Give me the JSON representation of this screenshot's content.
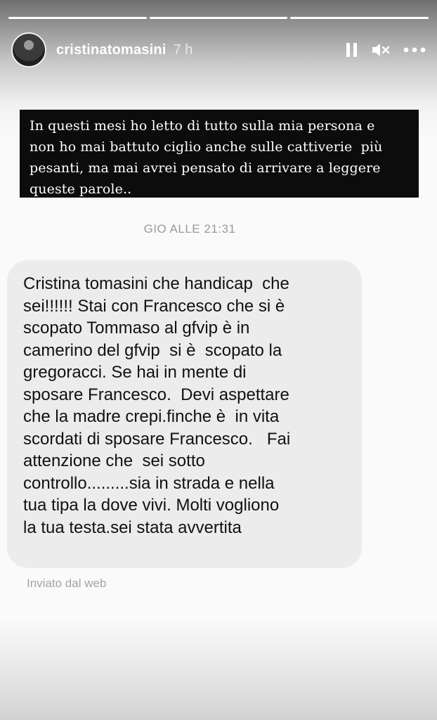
{
  "story": {
    "username": "cristinatomasini",
    "time": "7 h",
    "progress_segments": [
      "done",
      "done",
      "done"
    ],
    "controls": {
      "pause_icon": "pause-icon",
      "mute_icon": "volume-muted-icon",
      "more_icon": "more-horizontal-icon"
    }
  },
  "quote": {
    "lines": [
      "In questi mesi ho letto di tutto sulla mia persona e",
      "non ho mai battuto ciglio anche sulle cattiverie  più",
      "pesanti, ma mai avrei pensato di arrivare a leggere",
      "queste parole.."
    ]
  },
  "message": {
    "timestamp": "GIO ALLE 21:31",
    "lines": [
      "Cristina tomasini che handicap  che",
      "sei!!!!!! Stai con Francesco che si è",
      "scopato Tommaso al gfvip è in",
      "camerino del gfvip  si è  scopato la",
      "gregoracci. Se hai in mente di",
      "sposare Francesco.  Devi aspettare",
      "che la madre crepi.finche è  in vita",
      "scordati di sposare Francesco.   Fai",
      "attenzione che  sei sotto",
      "controllo.........sia in strada e nella",
      "tua tipa la dove vivi. Molti vogliono",
      "la tua testa.sei stata avvertita"
    ],
    "sent_label": "Inviato dal web"
  }
}
